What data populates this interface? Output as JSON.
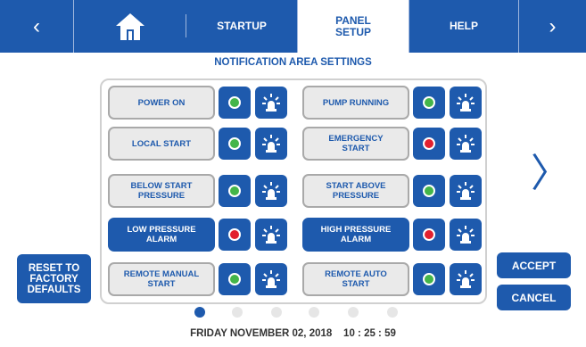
{
  "nav": {
    "back": "‹",
    "forward": "›",
    "tabs": [
      {
        "label": "STARTUP"
      },
      {
        "label": "PANEL\nSETUP"
      },
      {
        "label": "HELP"
      }
    ]
  },
  "heading": "NOTIFICATION AREA SETTINGS",
  "rows": [
    {
      "left": {
        "label": "POWER ON",
        "status": "green",
        "type": "normal"
      },
      "right": {
        "label": "PUMP RUNNING",
        "status": "green",
        "type": "normal"
      }
    },
    {
      "left": {
        "label": "LOCAL START",
        "status": "green",
        "type": "normal"
      },
      "right": {
        "label": "EMERGENCY\nSTART",
        "status": "red",
        "type": "normal"
      }
    },
    {
      "left": {
        "label": "BELOW START\nPRESSURE",
        "status": "green",
        "type": "normal"
      },
      "right": {
        "label": "START ABOVE\nPRESSURE",
        "status": "green",
        "type": "normal"
      }
    },
    {
      "left": {
        "label": "LOW PRESSURE\nALARM",
        "status": "red",
        "type": "alarm"
      },
      "right": {
        "label": "HIGH PRESSURE\nALARM",
        "status": "red",
        "type": "alarm"
      }
    },
    {
      "left": {
        "label": "REMOTE MANUAL\nSTART",
        "status": "green",
        "type": "normal"
      },
      "right": {
        "label": "REMOTE AUTO\nSTART",
        "status": "green",
        "type": "normal"
      }
    }
  ],
  "buttons": {
    "reset": "RESET TO\nFACTORY\nDEFAULTS",
    "accept": "ACCEPT",
    "cancel": "CANCEL",
    "next_page": "〉"
  },
  "pager": {
    "count": 6,
    "active": 0
  },
  "datetime": "FRIDAY NOVEMBER 02, 2018    10 : 25 : 59",
  "colors": {
    "primary": "#1e5aad",
    "green": "#44b549",
    "red": "#e2202f"
  }
}
